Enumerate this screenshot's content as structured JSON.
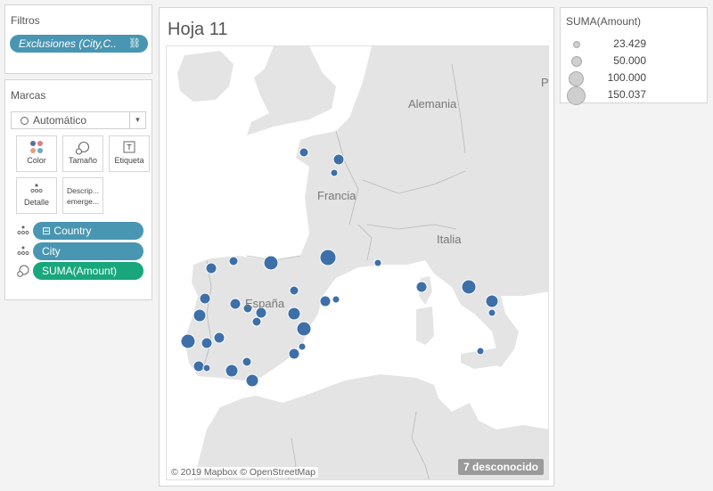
{
  "filters": {
    "title": "Filtros",
    "pill_label": "Exclusiones (City,C..",
    "pill_icon": "link-icon"
  },
  "marks": {
    "title": "Marcas",
    "mark_type": "Automático",
    "buttons": {
      "color": "Color",
      "size": "Tamaño",
      "label": "Etiqueta",
      "detail": "Detalle",
      "tooltip_line1": "Descrip...",
      "tooltip_line2": "emerge..."
    },
    "shelf": [
      {
        "icon": "detail-icon",
        "label": "Country",
        "prefix": "⊟",
        "color": "#4996b2"
      },
      {
        "icon": "detail-icon",
        "label": "City",
        "prefix": "",
        "color": "#4996b2"
      },
      {
        "icon": "size-icon",
        "label": "SUMA(Amount)",
        "prefix": "",
        "color": "#18a77c"
      }
    ]
  },
  "sheet": {
    "title": "Hoja 11",
    "country_labels": {
      "germany": "Alemania",
      "france": "Francia",
      "italy": "Italia",
      "spain": "España",
      "poland_partial": "P"
    },
    "attribution": "© 2019 Mapbox © OpenStreetMap",
    "unknown_badge": "7 desconocido",
    "mark_color": "#3d6fa8"
  },
  "legend": {
    "title": "SUMA(Amount)",
    "items": [
      {
        "value": "23.429"
      },
      {
        "value": "50.000"
      },
      {
        "value": "100.000"
      },
      {
        "value": "150.037"
      }
    ]
  }
}
